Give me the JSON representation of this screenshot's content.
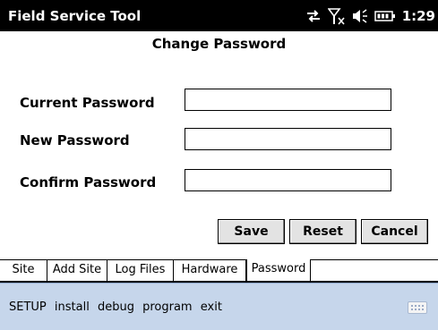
{
  "title_bar": {
    "app_title": "Field Service Tool",
    "clock": "1:29",
    "icons": [
      "connectivity-arrows-icon",
      "signal-off-icon",
      "speaker-icon",
      "battery-icon"
    ]
  },
  "page": {
    "title": "Change Password"
  },
  "form": {
    "current_password_label": "Current Password",
    "current_password_value": "",
    "new_password_label": "New Password",
    "new_password_value": "",
    "confirm_password_label": "Confirm Password",
    "confirm_password_value": ""
  },
  "buttons": {
    "save": "Save",
    "reset": "Reset",
    "cancel": "Cancel"
  },
  "tabs": [
    {
      "label": "Site",
      "active": false
    },
    {
      "label": "Add Site",
      "active": false
    },
    {
      "label": "Log Files",
      "active": false
    },
    {
      "label": "Hardware",
      "active": false
    },
    {
      "label": "Password",
      "active": true
    }
  ],
  "menu": {
    "items": [
      "SETUP",
      "install",
      "debug",
      "program",
      "exit"
    ],
    "keyboard_icon": "keyboard-icon"
  },
  "colors": {
    "title_bar": "#000000",
    "menu_bar": "#c6d6eb"
  }
}
